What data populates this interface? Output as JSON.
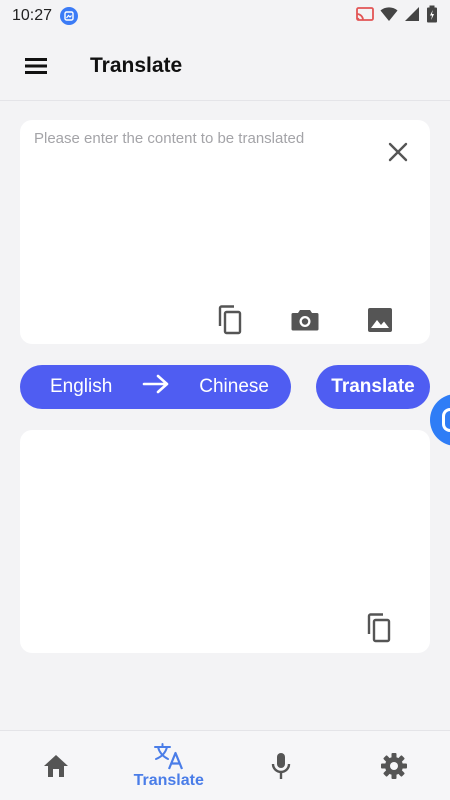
{
  "status_bar": {
    "time": "10:27"
  },
  "app_bar": {
    "title": "Translate"
  },
  "input": {
    "placeholder": "Please enter the content to be translated",
    "value": ""
  },
  "languages": {
    "source": "English",
    "target": "Chinese"
  },
  "actions": {
    "translate_label": "Translate"
  },
  "bottom_nav": {
    "items": [
      {
        "id": "home",
        "label": "",
        "icon": "home-icon"
      },
      {
        "id": "translate",
        "label": "Translate",
        "icon": "translate-icon",
        "active": true
      },
      {
        "id": "voice",
        "label": "",
        "icon": "microphone-icon"
      },
      {
        "id": "settings",
        "label": "",
        "icon": "gear-icon"
      }
    ]
  },
  "colors": {
    "accent": "#4f5df2",
    "active_nav": "#4a7de8",
    "background": "#f3f3f5"
  }
}
